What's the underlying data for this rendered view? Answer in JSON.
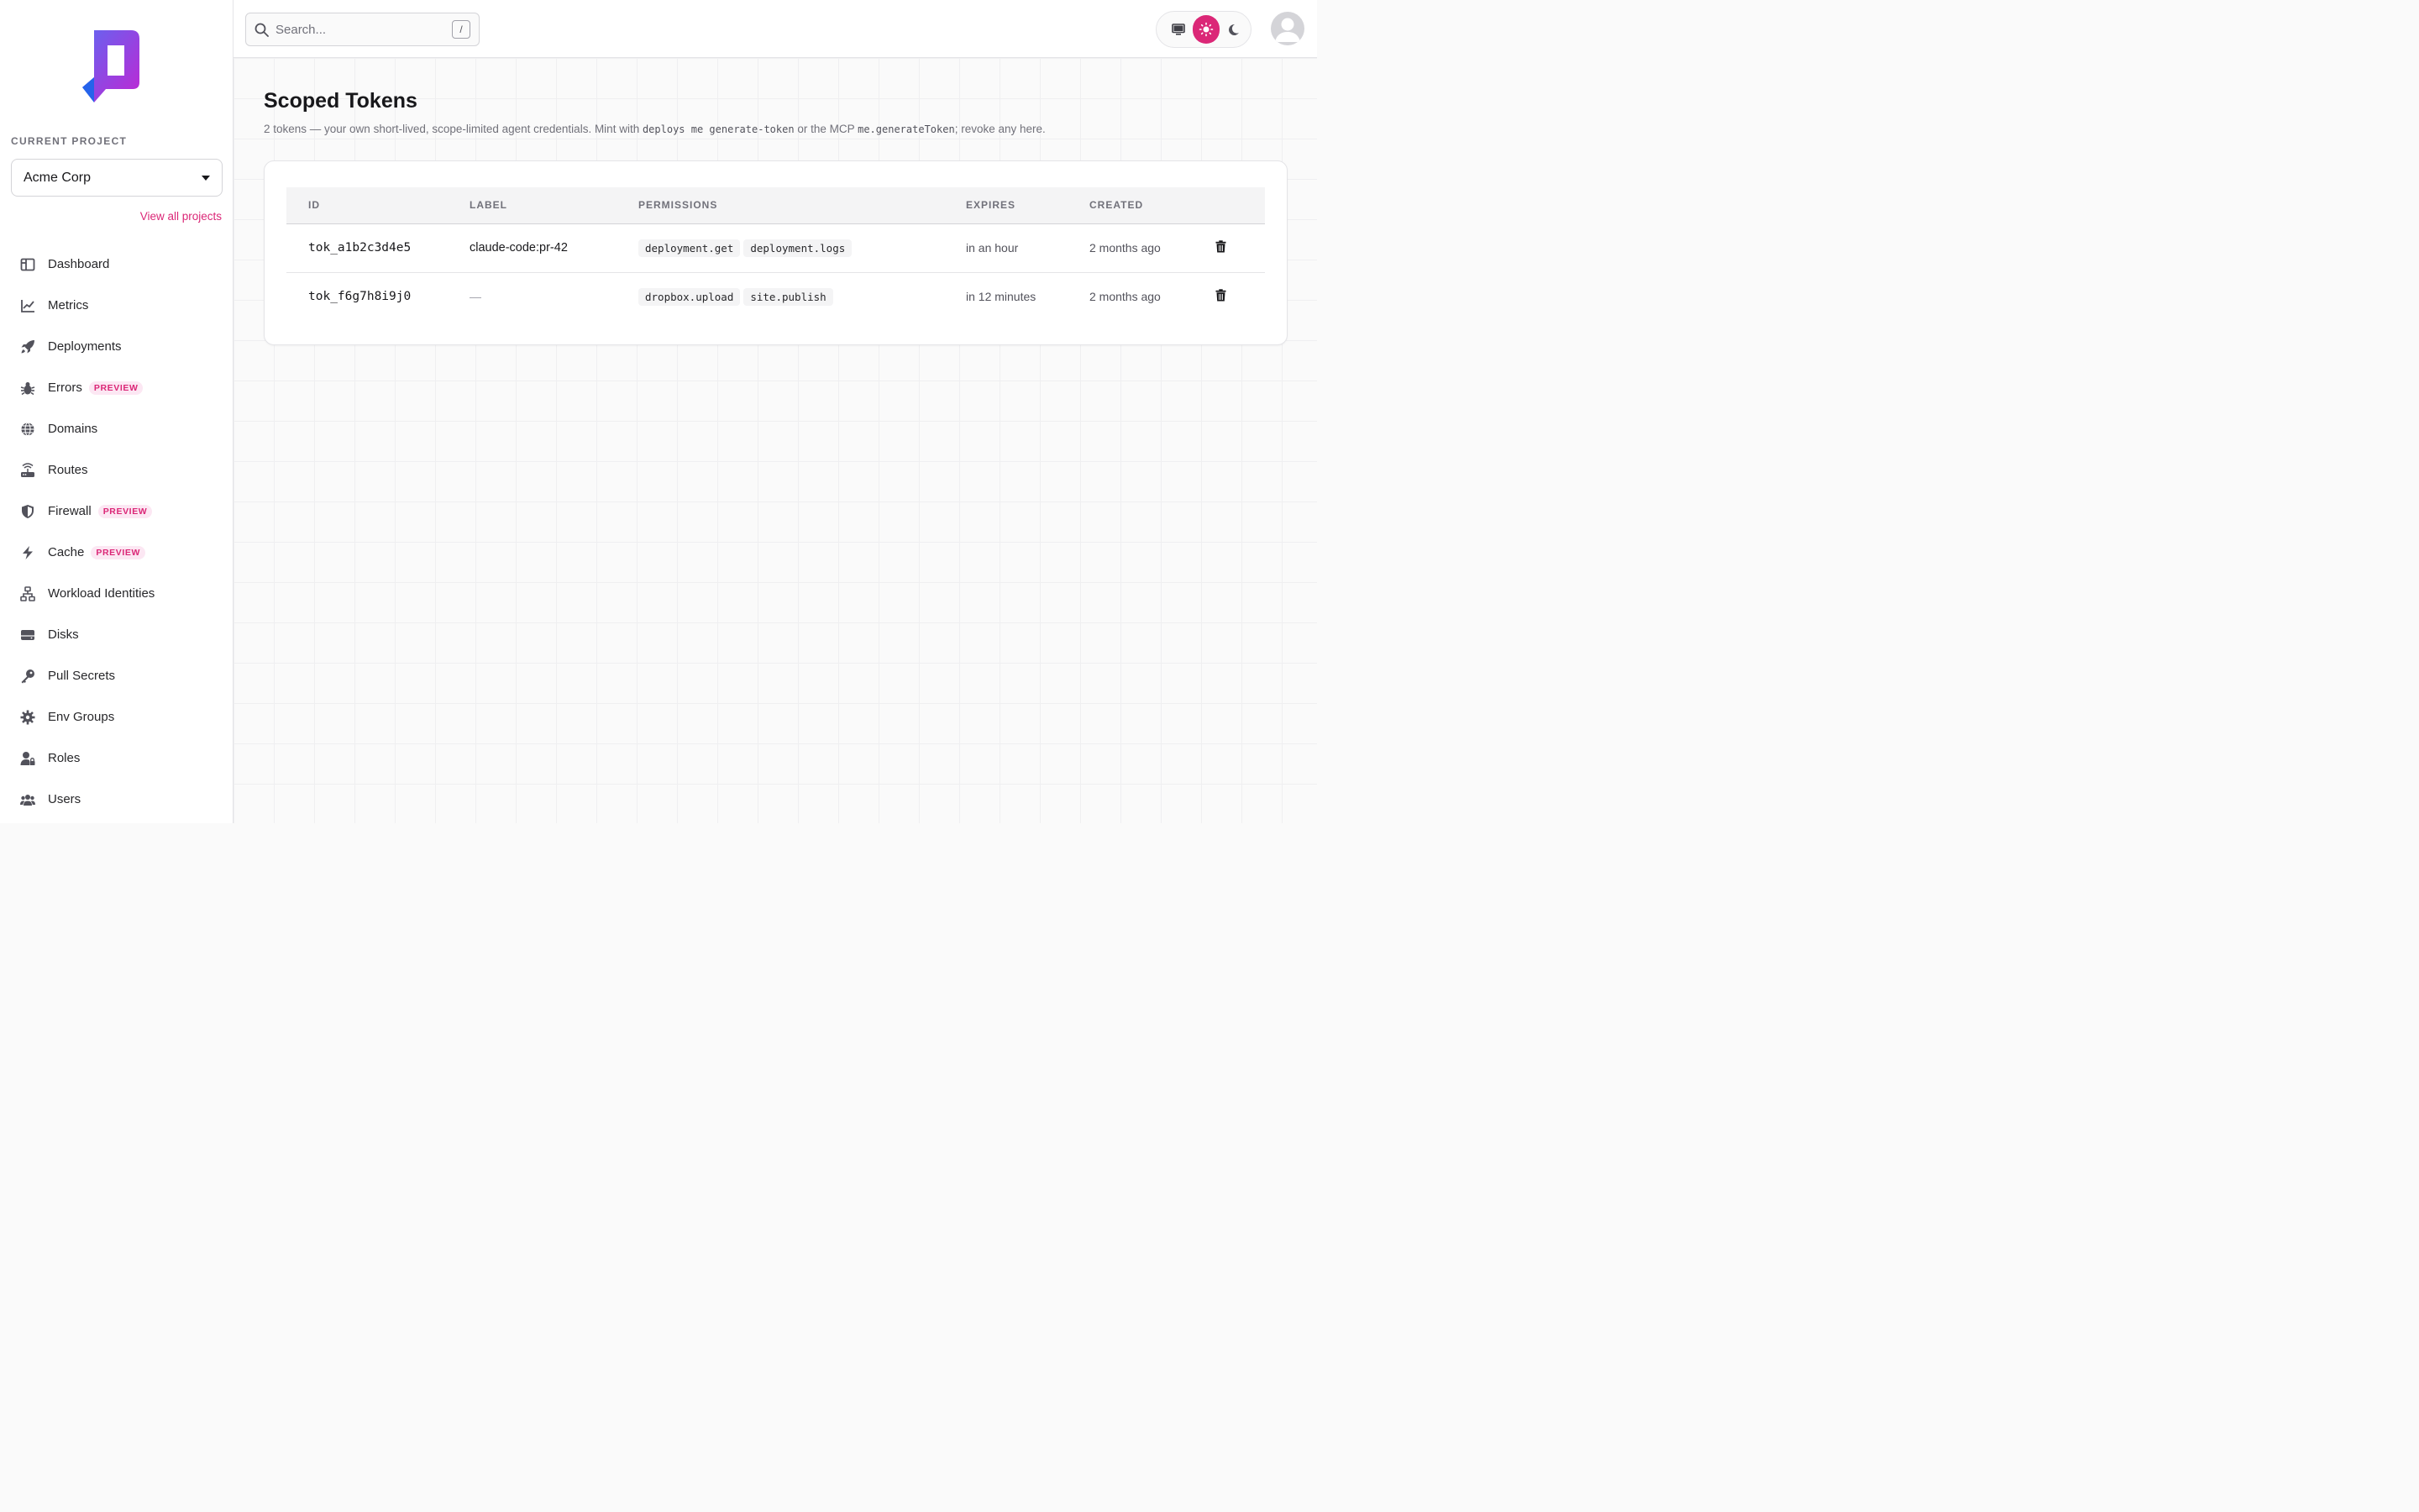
{
  "sidebar": {
    "project_label": "CURRENT PROJECT",
    "project_name": "Acme Corp",
    "view_all": "View all projects",
    "items": [
      {
        "label": "Dashboard"
      },
      {
        "label": "Metrics"
      },
      {
        "label": "Deployments"
      },
      {
        "label": "Errors",
        "badge": "PREVIEW"
      },
      {
        "label": "Domains"
      },
      {
        "label": "Routes"
      },
      {
        "label": "Firewall",
        "badge": "PREVIEW"
      },
      {
        "label": "Cache",
        "badge": "PREVIEW"
      },
      {
        "label": "Workload Identities"
      },
      {
        "label": "Disks"
      },
      {
        "label": "Pull Secrets"
      },
      {
        "label": "Env Groups"
      },
      {
        "label": "Roles"
      },
      {
        "label": "Users"
      }
    ]
  },
  "topbar": {
    "search_placeholder": "Search...",
    "search_shortcut": "/",
    "theme_active": "light"
  },
  "page": {
    "title": "Scoped Tokens",
    "subtitle_pre": "2 tokens — your own short-lived, scope-limited agent credentials. Mint with ",
    "subtitle_cmd": "deploys me generate-token",
    "subtitle_mid": " or the MCP ",
    "subtitle_mcp": "me.generateToken",
    "subtitle_post": "; revoke any here."
  },
  "table": {
    "headers": {
      "id": "ID",
      "label": "LABEL",
      "permissions": "PERMISSIONS",
      "expires": "EXPIRES",
      "created": "CREATED"
    },
    "rows": [
      {
        "id": "tok_a1b2c3d4e5",
        "label": "claude-code:pr-42",
        "permissions": [
          "deployment.get",
          "deployment.logs"
        ],
        "expires": "in an hour",
        "created": "2 months ago"
      },
      {
        "id": "tok_f6g7h8i9j0",
        "label": "—",
        "permissions": [
          "dropbox.upload",
          "site.publish"
        ],
        "expires": "in 12 minutes",
        "created": "2 months ago"
      }
    ]
  },
  "colors": {
    "accent": "#db2777",
    "logo_start": "#6366f1",
    "logo_end": "#c026d3"
  }
}
